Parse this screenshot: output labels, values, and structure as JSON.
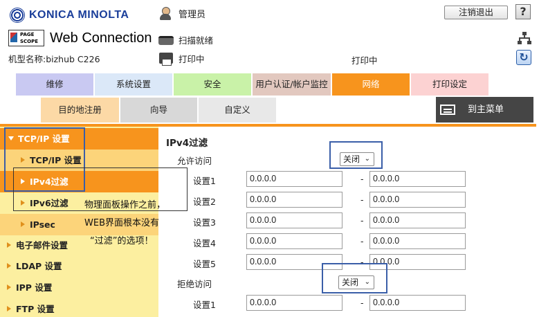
{
  "header": {
    "brand": "KONICA MINOLTA",
    "pagescope_line1": "PAGE",
    "pagescope_line2": "SCOPE",
    "product": "Web Connection",
    "model_label": "机型名称:bizhub C226",
    "user": "管理员",
    "scan_status": "扫描就绪",
    "print_status": "打印中",
    "print_status_2": "打印中",
    "logout_label": "注销退出",
    "help_label": "?",
    "refresh_label": "↻"
  },
  "tabs": [
    {
      "label": "维修",
      "color": "#c9c9f2"
    },
    {
      "label": "系统设置",
      "color": "#dbe8f8"
    },
    {
      "label": "安全",
      "color": "#c9f2a8"
    },
    {
      "label": "用户认证/帐户监控",
      "color": "#e2c8bf"
    },
    {
      "label": "网络",
      "color": "#f7941d",
      "active": true
    },
    {
      "label": "打印设定",
      "color": "#fcd2d2"
    }
  ],
  "subtabs": [
    {
      "label": "目的地注册",
      "color": "#fcd9a6"
    },
    {
      "label": "向导",
      "color": "#d8d8d8"
    },
    {
      "label": "自定义",
      "color": "#e8e8e8"
    }
  ],
  "main_menu_label": "到主菜单",
  "sidebar": {
    "items": [
      {
        "label": "TCP/IP 设置",
        "level": 0,
        "expanded": true
      },
      {
        "label": "TCP/IP 设置",
        "level": 1
      },
      {
        "label": "IPv4过滤",
        "level": 1,
        "active": true
      },
      {
        "label": "IPv6过滤",
        "level": 1
      },
      {
        "label": "IPsec",
        "level": 1
      },
      {
        "label": "电子邮件设置",
        "level": 0
      },
      {
        "label": "LDAP 设置",
        "level": 0
      },
      {
        "label": "IPP 设置",
        "level": 0
      },
      {
        "label": "FTP 设置",
        "level": 0
      }
    ]
  },
  "content": {
    "title": "IPv4过滤",
    "allow_label": "允许访问",
    "allow_value": "关闭",
    "deny_label": "拒绝访问",
    "deny_value": "关闭",
    "allow_rows": [
      {
        "label": "设置1",
        "from": "0.0.0.0",
        "to": "0.0.0.0"
      },
      {
        "label": "设置2",
        "from": "0.0.0.0",
        "to": "0.0.0.0"
      },
      {
        "label": "设置3",
        "from": "0.0.0.0",
        "to": "0.0.0.0"
      },
      {
        "label": "设置4",
        "from": "0.0.0.0",
        "to": "0.0.0.0"
      },
      {
        "label": "设置5",
        "from": "0.0.0.0",
        "to": "0.0.0.0"
      }
    ],
    "deny_rows": [
      {
        "label": "设置1",
        "from": "0.0.0.0",
        "to": "0.0.0.0"
      }
    ],
    "separator": "-"
  },
  "annotation": {
    "line1": "物理面板操作之前，",
    "line2": "WEB界面根本没有",
    "line3": "“过滤”的选项！"
  }
}
